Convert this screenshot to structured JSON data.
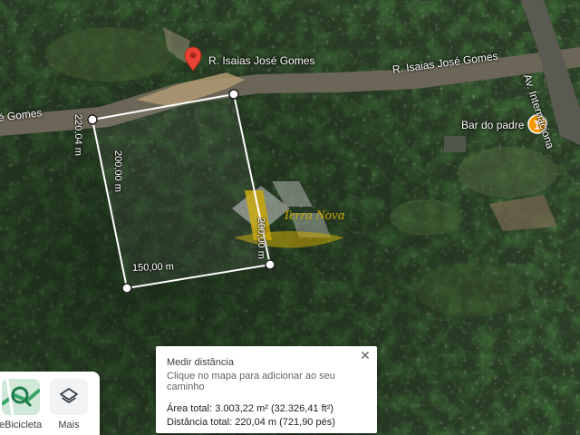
{
  "map": {
    "labels": {
      "street_left": "é Gomes",
      "street_center": "R. Isaias José Gomes",
      "street_right": "R. Isaias José Gomes",
      "avenue": "Av. Internaciona",
      "poi": "Bar do padre"
    },
    "measurement": {
      "edge_top_left": "220,04 m",
      "edge_left": "200,00 m",
      "edge_right": "200,00 m",
      "edge_bottom": "150,00 m"
    },
    "watermark": "Terra Nova"
  },
  "measure_panel": {
    "title": "Medir distância",
    "hint": "Clique no mapa para adicionar ao seu caminho",
    "area": "Área total: 3.003,22 m² (32.326,41 ft²)",
    "distance": "Distância total: 220,04 m (721,90 pés)",
    "close_icon": "close-icon"
  },
  "layers": {
    "bicycle_label": "eBicicleta",
    "more_label": "Mais",
    "bicycle_icon": "bicycle-layer-icon",
    "more_icon": "layers-icon"
  },
  "colors": {
    "pin": "#ea4335",
    "poi": "#f29900",
    "measure_line": "#ffffff"
  }
}
